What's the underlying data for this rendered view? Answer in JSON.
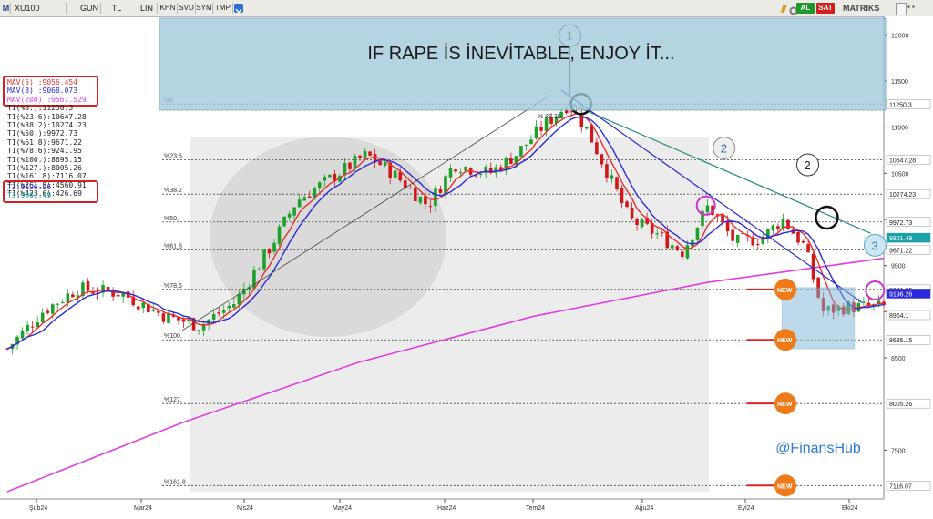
{
  "toolbar": {
    "symbol": "XU100",
    "menu_letter": "M",
    "period": "GUN",
    "currency": "TL",
    "scale": "LIN",
    "buttons": [
      "KHN",
      "SVD",
      "SYM",
      "TMP"
    ],
    "badges": [
      {
        "label": "AL",
        "color": "#1e9a2c"
      },
      {
        "label": "SAT",
        "color": "#cf1f1f"
      }
    ],
    "brand": "MATRIKS"
  },
  "banner": {
    "text": "IF RAPE İS İNEVİTABLE, ENJOY İT..."
  },
  "watermark": "@FinansHub",
  "indicator_legend": {
    "mav": [
      {
        "label": "MAV(5)",
        "value": ":9056.454",
        "color": "#e83030"
      },
      {
        "label": "MAV(8)",
        "value": ":9068.073",
        "color": "#2a2ad8"
      },
      {
        "label": "MAV(200)",
        "value": ":9567.529",
        "color": "#e040e0"
      }
    ],
    "fib_levels": [
      "T1(%0.):11250.3",
      "T1(%23.6):10647.28",
      "T1(%38.2):10274.23",
      "T1(%50.):9972.73",
      "T1(%61.8):9671.22",
      "T1(%78.6):9241.95",
      "T1(%100.):8695.15",
      "T1(%127.):8005.26",
      "T1(%161.8):7116.07",
      "T1(%261.8):4560.91",
      "T1(%423.6):426.69"
    ],
    "targets": [
      {
        "text": "T2:9196.26",
        "color": "#2a2ad8"
      },
      {
        "text": "T3:9801.49",
        "color": "#1a9aa0"
      }
    ]
  },
  "chart_data": {
    "type": "candlestick",
    "title": "IF RAPE İS İNEVİTABLE, ENJOY İT...",
    "x_ticks": [
      "Şub24",
      "Mar24",
      "Nis24",
      "May24",
      "Haz24",
      "Tem24",
      "Ağu24",
      "Eyl24",
      "Eki24"
    ],
    "y_ticks": [
      12000,
      11500,
      11000,
      10500,
      10000,
      9500,
      9000,
      8500,
      7500
    ],
    "ylim": [
      7050,
      12200
    ],
    "price_labels": [
      {
        "text": "11250.3",
        "value": 11250.3,
        "color": "#222222",
        "bg": "#ffffff"
      },
      {
        "text": "10647.28",
        "value": 10647.28,
        "color": "#222222",
        "bg": "#ffffff"
      },
      {
        "text": "10274.23",
        "value": 10274.23,
        "color": "#222222",
        "bg": "#ffffff"
      },
      {
        "text": "9972.73",
        "value": 9972.73,
        "color": "#222222",
        "bg": "#ffffff"
      },
      {
        "text": "9801.49",
        "value": 9801.49,
        "color": "#ffffff",
        "bg": "#1aa0a8"
      },
      {
        "text": "9671.22",
        "value": 9671.22,
        "color": "#222222",
        "bg": "#ffffff"
      },
      {
        "text": "9241.85",
        "value": 9241.85,
        "color": "#222222",
        "bg": "#ffffff"
      },
      {
        "text": "9196.26",
        "value": 9196.26,
        "color": "#ffffff",
        "bg": "#2a2ad8"
      },
      {
        "text": "8964.1",
        "value": 8964.1,
        "color": "#222222",
        "bg": "#ffffff"
      },
      {
        "text": "8695.15",
        "value": 8695.15,
        "color": "#222222",
        "bg": "#ffffff"
      },
      {
        "text": "8005.26",
        "value": 8005.26,
        "color": "#222222",
        "bg": "#ffffff"
      },
      {
        "text": "7116.07",
        "value": 7116.07,
        "color": "#222222",
        "bg": "#ffffff"
      }
    ],
    "fib_lines": [
      {
        "label": "%0.",
        "value": 11250.3
      },
      {
        "label": "%23.6",
        "value": 10647.28
      },
      {
        "label": "%38.2",
        "value": 10274.23
      },
      {
        "label": "%50.",
        "value": 9972.73
      },
      {
        "label": "%61.8",
        "value": 9671.22
      },
      {
        "label": "%78.6",
        "value": 9241.95
      },
      {
        "label": "%100.",
        "value": 8695.15
      },
      {
        "label": "%127.",
        "value": 8005.26
      },
      {
        "label": "%161.8",
        "value": 7116.07
      }
    ],
    "percent_annotation": "% 29.39",
    "new_markers": [
      {
        "text": "NEW",
        "value": 9241.95
      },
      {
        "text": "NEW",
        "value": 8695.15
      },
      {
        "text": "NEW",
        "value": 8005.26
      },
      {
        "text": "NEW",
        "value": 7116.07
      }
    ],
    "wave_labels": [
      {
        "text": "1",
        "x": 0.642,
        "value": 11250
      },
      {
        "text": "2",
        "x": 0.797,
        "value": 10300
      },
      {
        "text": "2",
        "x": 0.882,
        "value": 10000
      },
      {
        "text": "3",
        "x": 0.944,
        "value": 9250
      }
    ],
    "ma200": [
      [
        0.0,
        7050
      ],
      [
        0.2,
        7800
      ],
      [
        0.4,
        8450
      ],
      [
        0.6,
        8950
      ],
      [
        0.8,
        9320
      ],
      [
        1.0,
        9580
      ]
    ],
    "support_rect": [
      0.884,
      0.956,
      8600,
      9260
    ],
    "close_path": [
      [
        0.0,
        8600
      ],
      [
        0.04,
        9000
      ],
      [
        0.08,
        9250
      ],
      [
        0.13,
        9200
      ],
      [
        0.18,
        8950
      ],
      [
        0.22,
        8850
      ],
      [
        0.26,
        9100
      ],
      [
        0.3,
        9700
      ],
      [
        0.33,
        10200
      ],
      [
        0.37,
        10450
      ],
      [
        0.41,
        10700
      ],
      [
        0.44,
        10500
      ],
      [
        0.48,
        10150
      ],
      [
        0.51,
        10600
      ],
      [
        0.55,
        10500
      ],
      [
        0.58,
        10700
      ],
      [
        0.61,
        11000
      ],
      [
        0.64,
        11250
      ],
      [
        0.66,
        11000
      ],
      [
        0.68,
        10600
      ],
      [
        0.71,
        10000
      ],
      [
        0.74,
        9850
      ],
      [
        0.77,
        9650
      ],
      [
        0.8,
        10150
      ],
      [
        0.83,
        9750
      ],
      [
        0.86,
        9800
      ],
      [
        0.885,
        10000
      ],
      [
        0.91,
        9700
      ],
      [
        0.93,
        9000
      ],
      [
        0.956,
        9050
      ]
    ]
  }
}
